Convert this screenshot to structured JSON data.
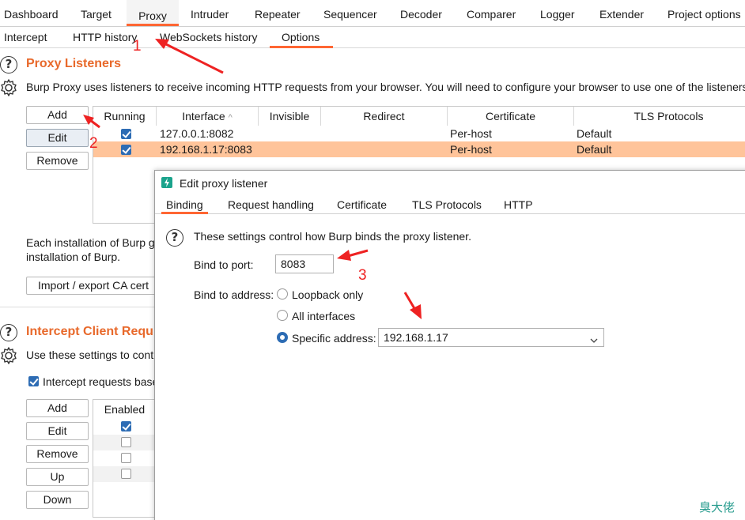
{
  "top_tabs": [
    "Dashboard",
    "Target",
    "Proxy",
    "Intruder",
    "Repeater",
    "Sequencer",
    "Decoder",
    "Comparer",
    "Logger",
    "Extender",
    "Project options"
  ],
  "sub_tabs": [
    "Intercept",
    "HTTP history",
    "WebSockets history",
    "Options"
  ],
  "proxy_listeners": {
    "title": "Proxy Listeners",
    "description": "Burp Proxy uses listeners to receive incoming HTTP requests from your browser. You will need to configure your browser to use one of the listeners",
    "buttons": [
      "Add",
      "Edit",
      "Remove"
    ],
    "columns": [
      "Running",
      "Interface",
      "Invisible",
      "Redirect",
      "Certificate",
      "TLS Protocols"
    ],
    "sort_indicator": "^",
    "rows": [
      {
        "running": true,
        "interface": "127.0.0.1:8082",
        "invisible": "",
        "redirect": "",
        "certificate": "Per-host",
        "tls": "Default"
      },
      {
        "running": true,
        "interface": "192.168.1.17:8083",
        "invisible": "",
        "redirect": "",
        "certificate": "Per-host",
        "tls": "Default"
      }
    ],
    "ca_text_1": "Each installation of Burp g",
    "ca_text_2": "installation of Burp.",
    "import_button": "Import / export CA cert"
  },
  "intercept_client": {
    "title": "Intercept Client Requ",
    "description": "Use these settings to cont",
    "checkbox_label": "Intercept requests base",
    "checkbox_checked": true,
    "buttons": [
      "Add",
      "Edit",
      "Remove",
      "Up",
      "Down"
    ],
    "column": "Enabled",
    "rows_enabled": [
      true,
      false,
      false,
      false
    ]
  },
  "dialog": {
    "title": "Edit proxy listener",
    "tabs": [
      "Binding",
      "Request handling",
      "Certificate",
      "TLS Protocols",
      "HTTP"
    ],
    "help_text": "These settings control how Burp binds the proxy listener.",
    "bind_port_label": "Bind to port:",
    "bind_port_value": "8083",
    "bind_address_label": "Bind to address:",
    "options": [
      "Loopback only",
      "All interfaces",
      "Specific address:"
    ],
    "selected_option": 2,
    "specific_address": "192.168.1.17"
  },
  "annotations": [
    "1",
    "2",
    "3"
  ],
  "watermark": "臭大佬",
  "colors": {
    "accent": "#ff6633",
    "title_orange": "#e8692b",
    "selected_row": "#ffc49a",
    "checkbox_blue": "#2d6cb4",
    "annotation_red": "#ee2222",
    "watermark": "#2a9d8f"
  }
}
